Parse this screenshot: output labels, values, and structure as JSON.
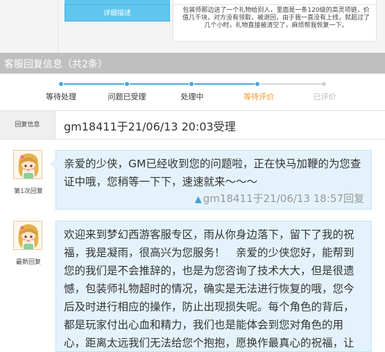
{
  "detail": {
    "label": "详细描述",
    "content": "包装师那边送了一个礼物给别人，里面是一条120级的高灵项链，价值几千块，对方没有领取，被退回，由于我一直没有上线，就超过了几个小时，礼物直接被清空了，麻烦帮我恢复一下。"
  },
  "section": {
    "title": "客服回复信息（共2条）"
  },
  "progress": {
    "steps": [
      {
        "label": "等待处理",
        "state": "done"
      },
      {
        "label": "问题已受理",
        "state": "done"
      },
      {
        "label": "处理中",
        "state": "done"
      },
      {
        "label": "等待评价",
        "state": "current"
      },
      {
        "label": "已评价",
        "state": "future"
      }
    ]
  },
  "reply_info": {
    "label": "回复信息",
    "text": "gm18411于21/06/13 20:03受理"
  },
  "replies": [
    {
      "who": "第1次回复",
      "text": "亲爱的少侠，GM已经收到您的问题啦，正在快马加鞭的为您查证中哦，您稍等一下下，速速就来～～～",
      "sign": "gm18411于21/06/13 18:57回复"
    },
    {
      "who": "最新回复",
      "text": "欢迎来到梦幻西游客服专区，雨从你身边落下，留下了我的祝福，我是凝雨，很高兴为您服务！　亲爱的少侠您好，能帮到您的我们是不会推辞的，也是为您咨询了技术大大，但是很遗憾，包装师礼物超时的情况，确实是无法进行恢复的哦，您今后及时进行相应的操作，防止出现损失呢。每个角色的背后，都是玩家付出心血和精力，我们也是能体会到您对角色的用心，距离太远我们无法给您个抱抱，愿换作最真心的祝福，让"
    }
  ]
}
